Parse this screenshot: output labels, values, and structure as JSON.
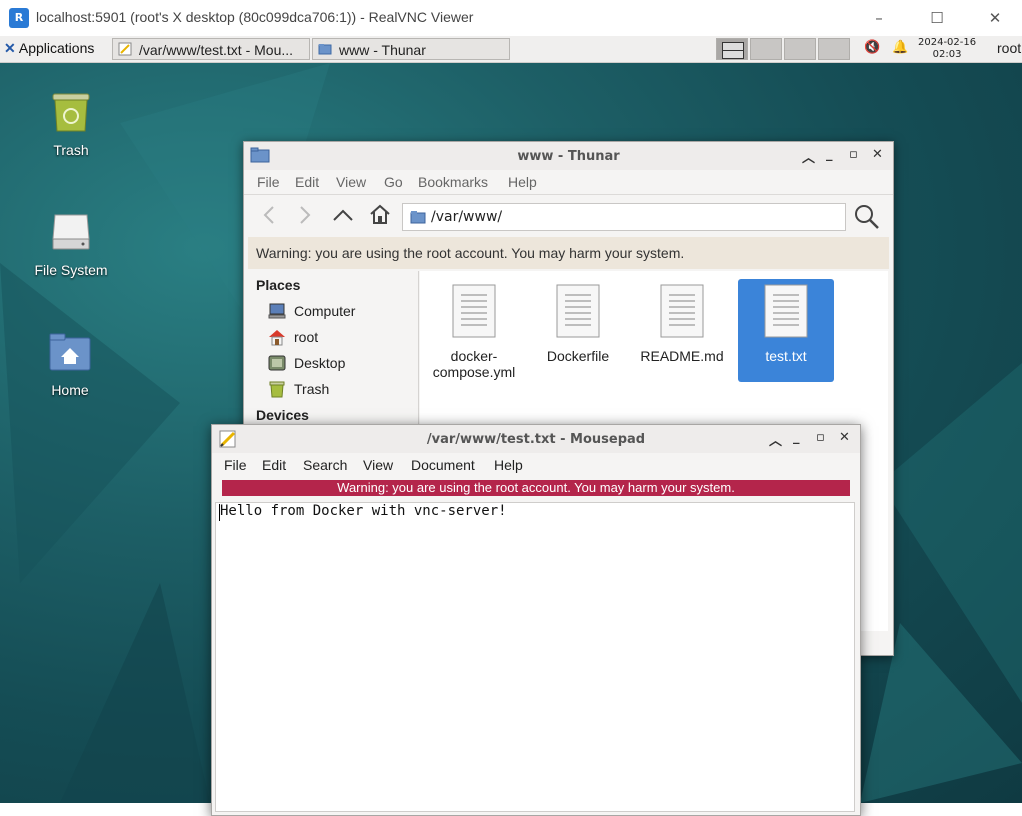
{
  "vnc": {
    "title": "localhost:5901 (root's X desktop (80c099dca706:1)) - RealVNC Viewer",
    "logo_text": "R",
    "minimize": "–",
    "maximize": "☐",
    "close": "✕"
  },
  "panel": {
    "applications": "Applications",
    "tasks": [
      {
        "label": "/var/www/test.txt - Mou..."
      },
      {
        "label": "www - Thunar"
      }
    ],
    "clock_date": "2024-02-16",
    "clock_time": "02:03",
    "user": "root",
    "mute_icon": "🔇",
    "bell_icon": "🔔"
  },
  "desktop": {
    "icons": [
      {
        "label": "Trash"
      },
      {
        "label": "File System"
      },
      {
        "label": "Home"
      }
    ]
  },
  "thunar": {
    "title": "www - Thunar",
    "menu": [
      "File",
      "Edit",
      "View",
      "Go",
      "Bookmarks",
      "Help"
    ],
    "path": "/var/www/",
    "warning": "Warning: you are using the root account. You may harm your system.",
    "places_header": "Places",
    "places": [
      "Computer",
      "root",
      "Desktop",
      "Trash"
    ],
    "devices_header": "Devices",
    "files": [
      {
        "name_line1": "docker-",
        "name_line2": "compose.yml"
      },
      {
        "name_line1": "Dockerfile",
        "name_line2": ""
      },
      {
        "name_line1": "README.md",
        "name_line2": ""
      },
      {
        "name_line1": "test.txt",
        "name_line2": ""
      }
    ]
  },
  "mousepad": {
    "title": "/var/www/test.txt - Mousepad",
    "menu": [
      "File",
      "Edit",
      "Search",
      "View",
      "Document",
      "Help"
    ],
    "warning": "Warning: you are using the root account. You may harm your system.",
    "content": "Hello from Docker with vnc-server!"
  },
  "colors": {
    "selection": "#3b84d9",
    "mousepad_warning": "#b4254b",
    "thunar_warning": "#ede6db"
  }
}
